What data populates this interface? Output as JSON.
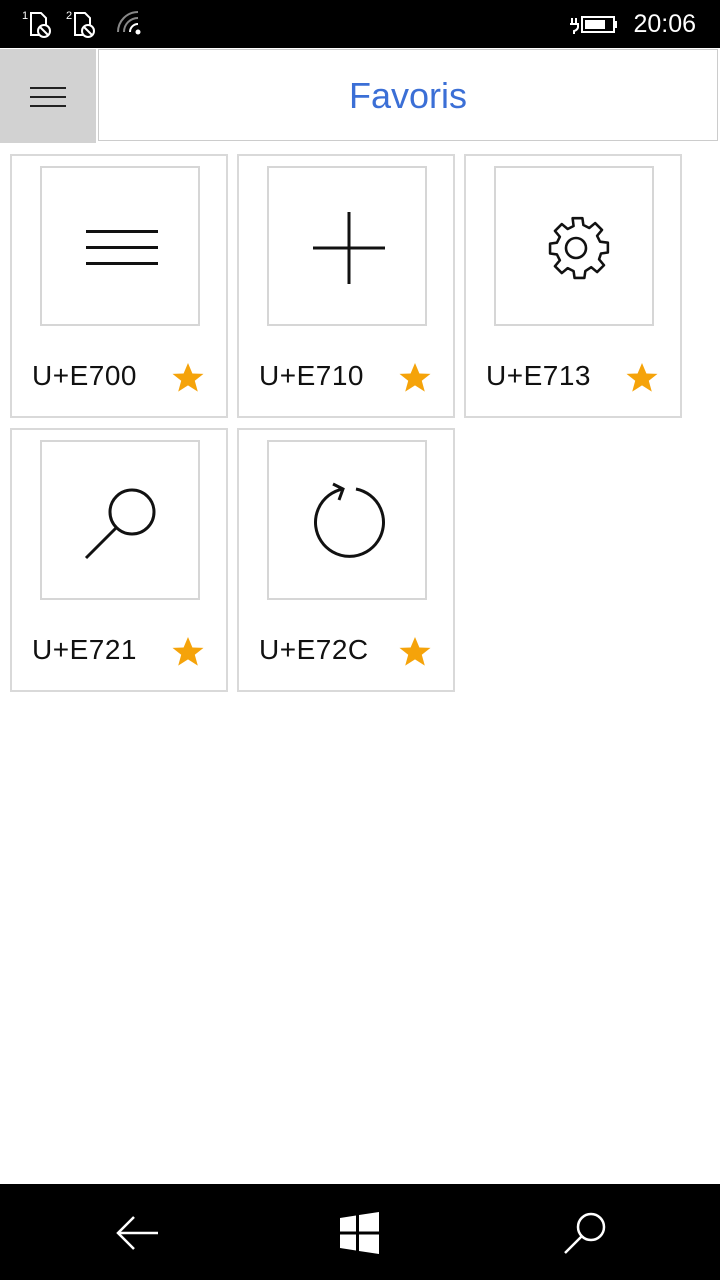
{
  "status_bar": {
    "sim1_label": "1",
    "sim2_label": "2",
    "time": "20:06",
    "icons": [
      "sim-1-no-service-icon",
      "sim-2-no-service-icon",
      "wifi-icon",
      "battery-charging-icon"
    ]
  },
  "header": {
    "title": "Favoris",
    "menu_icon": "hamburger-icon"
  },
  "tiles": [
    {
      "code": "U+E700",
      "glyph": "global-nav-icon",
      "favorite": true
    },
    {
      "code": "U+E710",
      "glyph": "add-icon",
      "favorite": true
    },
    {
      "code": "U+E713",
      "glyph": "settings-icon",
      "favorite": true
    },
    {
      "code": "U+E721",
      "glyph": "search-icon",
      "favorite": true
    },
    {
      "code": "U+E72C",
      "glyph": "refresh-icon",
      "favorite": true
    }
  ],
  "nav_bar": {
    "icons": [
      "back-arrow-icon",
      "windows-start-icon",
      "search-icon"
    ]
  },
  "colors": {
    "title": "#3b6fd6",
    "star": "#f5a30a",
    "menu_button_bg": "#d2d2d2",
    "tile_border": "#d9d9d9"
  }
}
